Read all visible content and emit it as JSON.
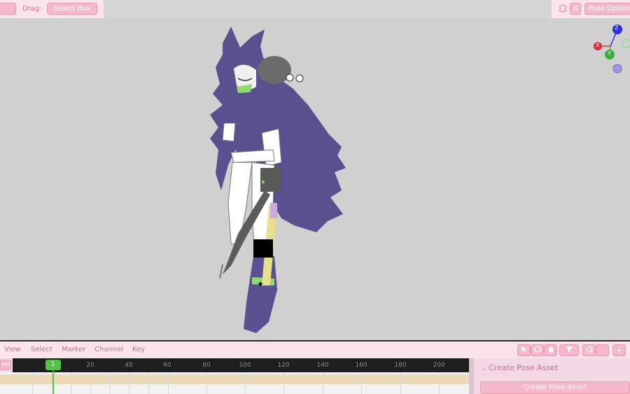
{
  "header": {
    "drag_label": "Drag:",
    "drag_mode": "Select Box",
    "close_label": "X",
    "pose_options_label": "Pose Options"
  },
  "timeline": {
    "menu": [
      "View",
      "Select",
      "Marker",
      "Channel",
      "Key"
    ],
    "current_frame": "1",
    "ticks": [
      "20",
      "40",
      "60",
      "80",
      "100",
      "120",
      "140",
      "160",
      "180",
      "200"
    ],
    "tools": [
      "cursor-icon",
      "circle-icon",
      "ghost-icon",
      "filter-icon",
      "snap-icon",
      "blank-icon",
      "plus-icon"
    ]
  },
  "side_panel": {
    "title": "Create Pose Asset",
    "button_label": "Create Pose Asset"
  },
  "gizmo": {
    "x_label": "X",
    "y_label": "Y",
    "z_label": "Z",
    "x_color": "#d6303a",
    "y_color": "#38b03a",
    "z_color": "#2d2ed8"
  },
  "colors": {
    "accent_pink": "#f6b8cb",
    "cape_purple": "#5a4f8f",
    "playhead_green": "#54c248"
  }
}
